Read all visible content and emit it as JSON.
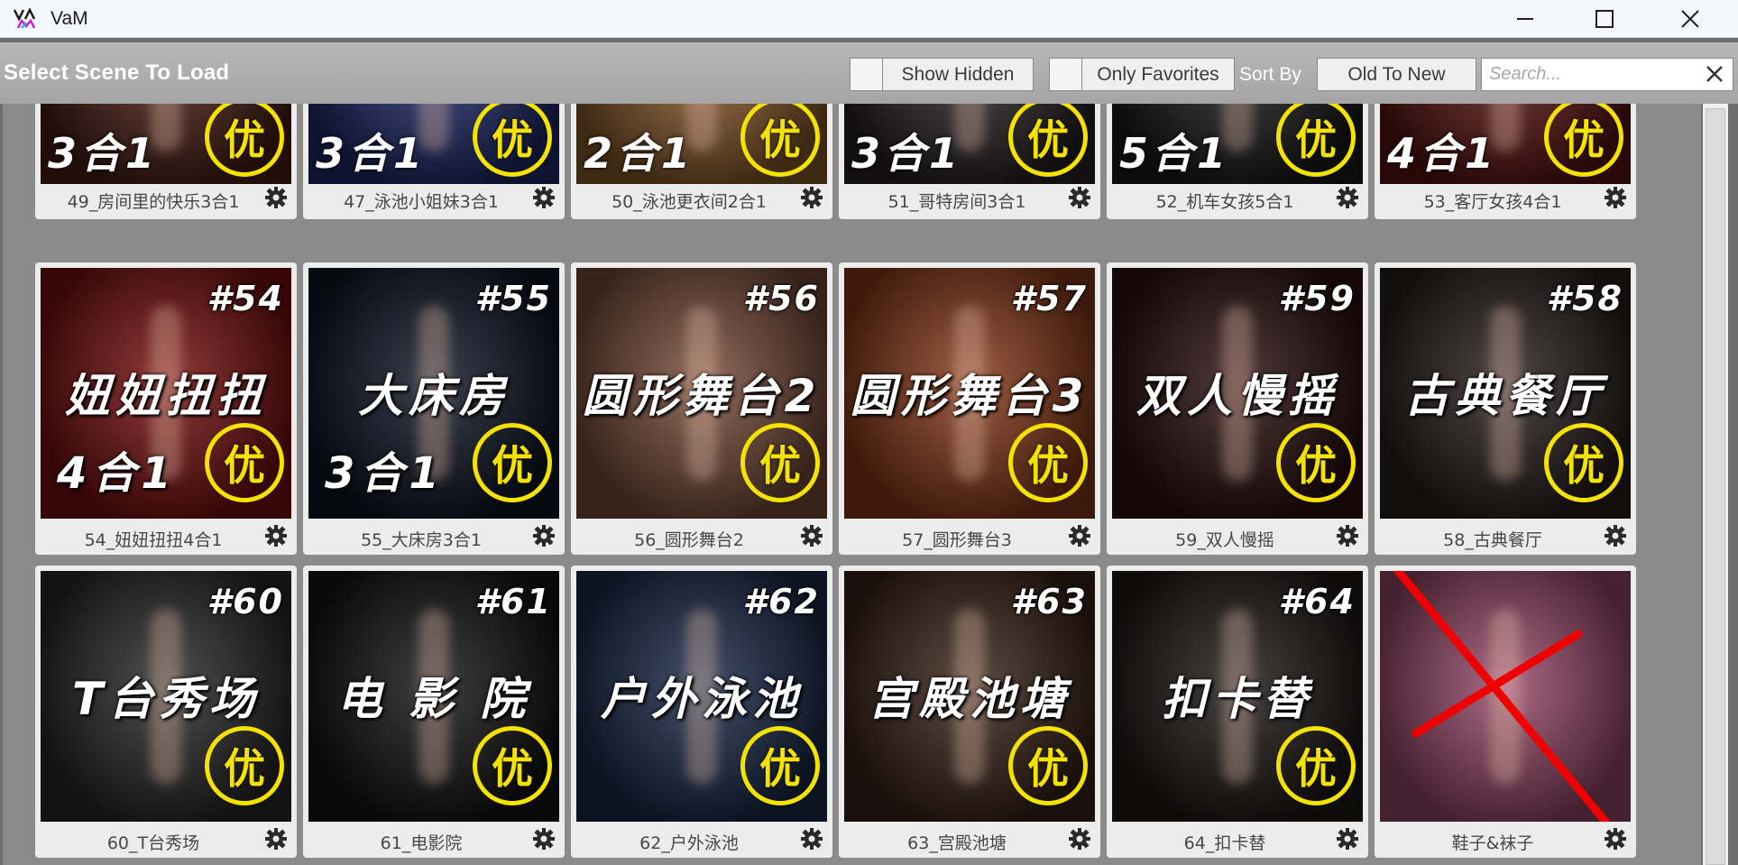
{
  "window": {
    "title": "VaM",
    "icon": "vam-logo-icon"
  },
  "header": {
    "title": "Select Scene To Load",
    "show_hidden_label": "Show Hidden",
    "only_favorites_label": "Only Favorites",
    "sort_by_label": "Sort By",
    "sort_value": "Old To New",
    "search_placeholder": "Search..."
  },
  "colors": {
    "accent_yellow": "#f4e200",
    "header_bg": "#a5a5a5",
    "panel_bg": "#8b8b8b",
    "card_bg": "#ececec"
  },
  "scenes": [
    {
      "caption": "49_房间里的快乐3合1",
      "sub": "3合1",
      "badge": "优",
      "bg": "#4a1e14"
    },
    {
      "caption": "47_泳池小姐妹3合1",
      "sub": "3合1",
      "badge": "优",
      "bg": "#1f2a6b"
    },
    {
      "caption": "50_泳池更衣间2合1",
      "sub": "2合1",
      "badge": "优",
      "bg": "#8a5a2a"
    },
    {
      "caption": "51_哥特房间3合1",
      "sub": "3合1",
      "badge": "优",
      "bg": "#2a2224"
    },
    {
      "caption": "52_机车女孩5合1",
      "sub": "5合1",
      "badge": "优",
      "bg": "#1a1a1a"
    },
    {
      "caption": "53_客厅女孩4合1",
      "sub": "4合1",
      "badge": "优",
      "bg": "#5a1410"
    },
    {
      "caption": "54_妞妞扭扭4合1",
      "tag": "#54",
      "line1": "妞妞扭扭",
      "line2": "4合1",
      "badge": "优",
      "bg": "#7a0f0f"
    },
    {
      "caption": "55_大床房3合1",
      "tag": "#55",
      "line1": "大床房",
      "line2": "3合1",
      "badge": "优",
      "bg": "#101626"
    },
    {
      "caption": "56_圆形舞台2",
      "tag": "#56",
      "line1": "圆形舞台2",
      "line2": "",
      "badge": "优",
      "bg": "#7a4d3a"
    },
    {
      "caption": "57_圆形舞台3",
      "tag": "#57",
      "line1": "圆形舞台3",
      "line2": "",
      "badge": "优",
      "bg": "#8a3a1a"
    },
    {
      "caption": "59_双人慢摇",
      "tag": "#59",
      "line1": "双人慢摇",
      "line2": "",
      "badge": "优",
      "bg": "#2a0f0f"
    },
    {
      "caption": "58_古典餐厅",
      "tag": "#58",
      "line1": "古典餐厅",
      "line2": "",
      "badge": "优",
      "bg": "#2a1e1e"
    },
    {
      "caption": "60_T台秀场",
      "tag": "#60",
      "line1": "T台秀场",
      "line2": "",
      "badge": "优",
      "bg": "#2a2a2a"
    },
    {
      "caption": "61_电影院",
      "tag": "#61",
      "line1": "电 影 院",
      "line2": "",
      "badge": "优",
      "bg": "#141416"
    },
    {
      "caption": "62_户外泳池",
      "tag": "#62",
      "line1": "户外泳池",
      "line2": "",
      "badge": "优",
      "bg": "#1a2a4a"
    },
    {
      "caption": "63_宫殿池塘",
      "tag": "#63",
      "line1": "宫殿池塘",
      "line2": "",
      "badge": "优",
      "bg": "#3a2418"
    },
    {
      "caption": "64_扣卡替",
      "tag": "#64",
      "line1": "扣卡替",
      "line2": "",
      "badge": "优",
      "bg": "#1e1818"
    },
    {
      "caption": "鞋子&袜子",
      "tag": "",
      "line1": "",
      "line2": "",
      "badge": "",
      "bg": "#9a4a6a",
      "crossed": true
    }
  ]
}
